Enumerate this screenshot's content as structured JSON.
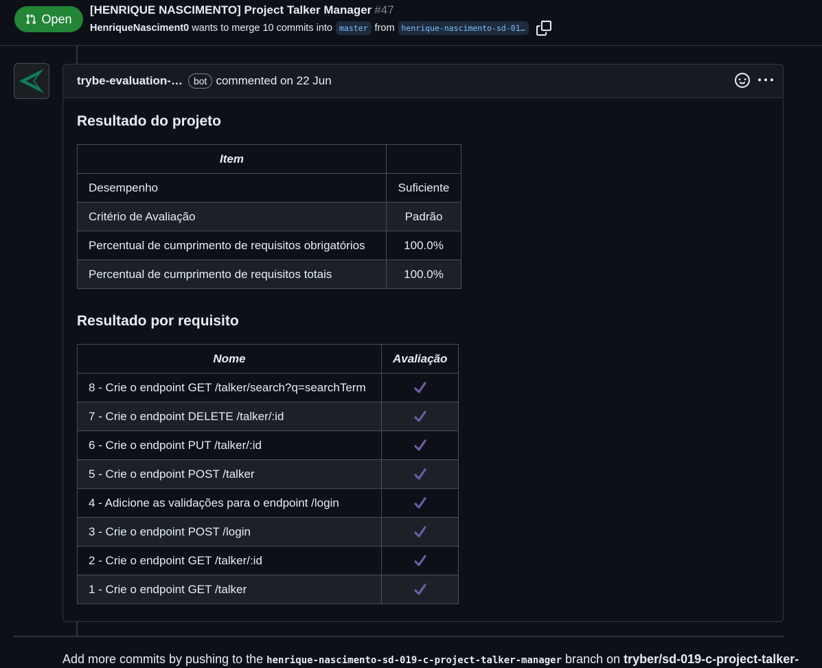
{
  "header": {
    "state_label": "Open",
    "title": "[HENRIQUE NASCIMENTO] Project Talker Manager",
    "number": "#47",
    "author": "HenriqueNasciment0",
    "merge_text": "wants to merge 10 commits into",
    "base_branch": "master",
    "from_text": "from",
    "head_branch": "henrique-nascimento-sd-01…"
  },
  "comment": {
    "author": "trybe-evaluation-…",
    "badge": "bot",
    "timestamp": "commented on 22 Jun",
    "section1_title": "Resultado do projeto",
    "table1": {
      "headers": [
        "Item",
        ""
      ],
      "rows": [
        [
          "Desempenho",
          "Suficiente"
        ],
        [
          "Critério de Avaliação",
          "Padrão"
        ],
        [
          "Percentual de cumprimento de requisitos obrigatórios",
          "100.0%"
        ],
        [
          "Percentual de cumprimento de requisitos totais",
          "100.0%"
        ]
      ]
    },
    "section2_title": "Resultado por requisito",
    "table2": {
      "headers": [
        "Nome",
        "Avaliação"
      ],
      "rows": [
        "8 - Crie o endpoint GET /talker/search?q=searchTerm",
        "7 - Crie o endpoint DELETE /talker/:id",
        "6 - Crie o endpoint PUT /talker/:id",
        "5 - Crie o endpoint POST /talker",
        "4 - Adicione as validações para o endpoint /login",
        "3 - Crie o endpoint POST /login",
        "2 - Crie o endpoint GET /talker/:id",
        "1 - Crie o endpoint GET /talker"
      ]
    }
  },
  "footer": {
    "prefix": "Add more commits by pushing to the",
    "branch": "henrique-nascimento-sd-019-c-project-talker-manager",
    "middle": "branch on",
    "repo": "tryber/sd-019-c-project-talker-"
  },
  "colors": {
    "open_green": "#238636",
    "check_purple": "#6e5ba8",
    "branch_blue": "#79c0ff"
  }
}
